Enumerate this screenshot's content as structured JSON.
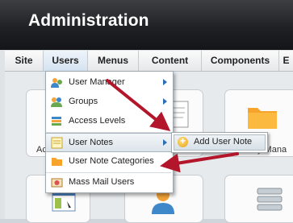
{
  "header": {
    "title": "Administration"
  },
  "menubar": {
    "items": [
      {
        "label": "Site"
      },
      {
        "label": "Users"
      },
      {
        "label": "Menus"
      },
      {
        "label": "Content"
      },
      {
        "label": "Components"
      },
      {
        "label": "E"
      }
    ]
  },
  "users_menu": {
    "items": [
      {
        "label": "User Manager",
        "icon": "user-manager-icon",
        "has_submenu": true
      },
      {
        "label": "Groups",
        "icon": "groups-icon",
        "has_submenu": true
      },
      {
        "label": "Access Levels",
        "icon": "access-levels-icon"
      },
      {
        "label": "User Notes",
        "icon": "user-notes-icon",
        "has_submenu": true,
        "highlighted": true
      },
      {
        "label": "User Note Categories",
        "icon": "folder-icon"
      },
      {
        "label": "Mass Mail Users",
        "icon": "mass-mail-icon"
      }
    ]
  },
  "submenu": {
    "add_label": "Add User Note"
  },
  "tiles": {
    "left_label": "Ac",
    "right_label": "y Mana"
  },
  "colors": {
    "arrow": "#b3162a",
    "accent": "#2c6fb2",
    "header": "#1f2124"
  }
}
